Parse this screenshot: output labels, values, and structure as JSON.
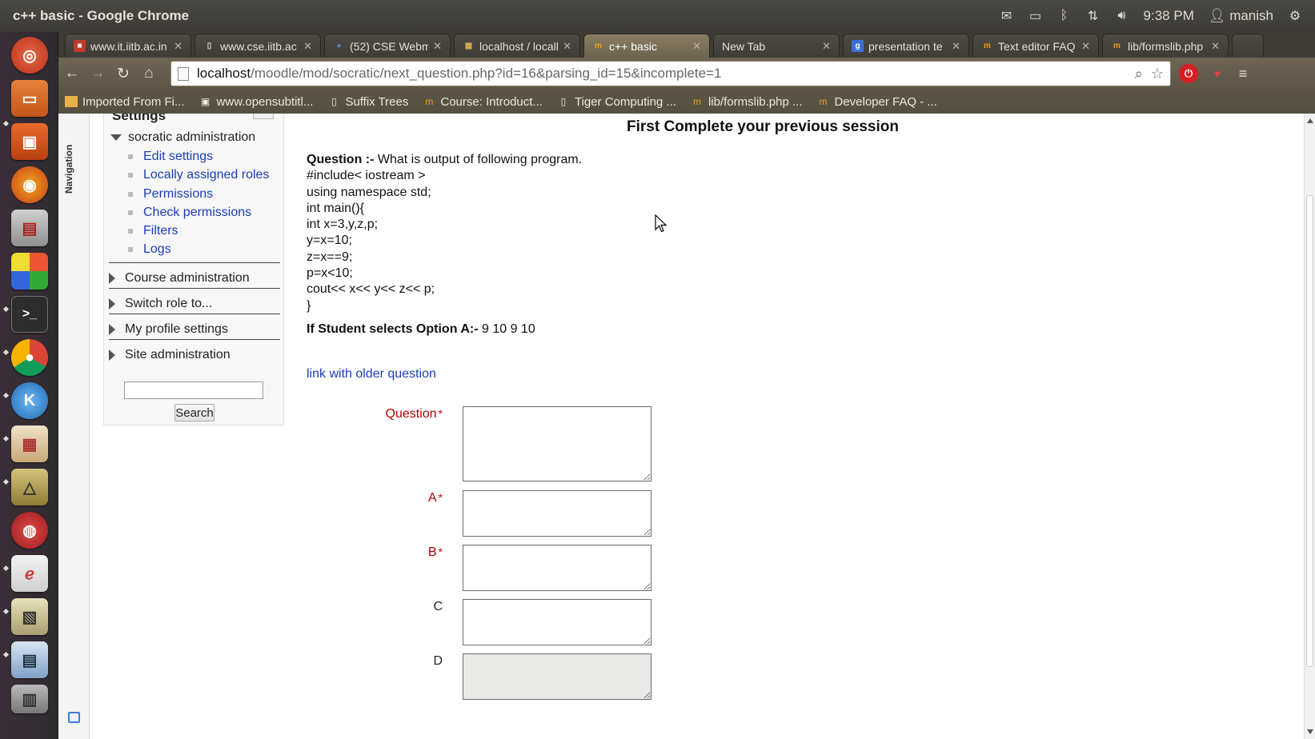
{
  "window_title": "c++ basic - Google Chrome",
  "panel": {
    "time": "9:38 PM",
    "user": "manish",
    "icons": [
      "mail-icon",
      "battery-icon",
      "bluetooth-icon",
      "network-icon",
      "volume-icon",
      "power-icon"
    ]
  },
  "tabs": [
    {
      "label": "www.it.iitb.ac.in",
      "icon_color": "#c0392b",
      "icon_char": "■"
    },
    {
      "label": "www.cse.iitb.ac",
      "icon_color": "#dddddd",
      "icon_char": "▯"
    },
    {
      "label": "(52) CSE Webma",
      "icon_color": "#4a7fd4",
      "icon_char": "●"
    },
    {
      "label": "localhost / locall",
      "icon_color": "#d9b24a",
      "icon_char": "▦"
    },
    {
      "label": "c++ basic",
      "icon_color": "#f29c1f",
      "icon_char": "m"
    },
    {
      "label": "New Tab",
      "icon_color": "",
      "icon_char": ""
    },
    {
      "label": "presentation te",
      "icon_color": "#3b6fd8",
      "icon_char": "g"
    },
    {
      "label": "Text editor FAQ",
      "icon_color": "#f29c1f",
      "icon_char": "m"
    },
    {
      "label": "lib/formslib.php",
      "icon_color": "#f29c1f",
      "icon_char": "m"
    }
  ],
  "omnibox": {
    "host": "localhost",
    "path": "/moodle/mod/socratic/next_question.php?id=16&parsing_id=15&incomplete=1"
  },
  "bookmarks": [
    {
      "label": "Imported From Fi...",
      "icon": "folder-icon"
    },
    {
      "label": "www.opensubtitl...",
      "icon": "film-icon"
    },
    {
      "label": "Suffix Trees",
      "icon": "page-icon"
    },
    {
      "label": "Course: Introduct...",
      "icon": "moodle-icon"
    },
    {
      "label": "Tiger Computing ...",
      "icon": "page-icon"
    },
    {
      "label": "lib/formslib.php ...",
      "icon": "moodle-icon"
    },
    {
      "label": "Developer FAQ - ...",
      "icon": "moodle-icon"
    }
  ],
  "nav_strip_label": "Navigation",
  "settings": {
    "title": "Settings",
    "root": "socratic administration",
    "links": [
      "Edit settings",
      "Locally assigned roles",
      "Permissions",
      "Check permissions",
      "Filters",
      "Logs"
    ],
    "branches": [
      "Course administration",
      "Switch role to...",
      "My profile settings",
      "Site administration"
    ],
    "search_value": "",
    "search_button": "Search"
  },
  "main": {
    "heading": "First Complete your previous session",
    "question_label": "Question :-",
    "question_text": "What is output of following program.",
    "code_lines": [
      "#include< iostream >",
      "using namespace std;",
      "int main(){",
      "int x=3,y,z,p;",
      "y=x=10;",
      "z=x==9;",
      "p=x<10;",
      "cout<< x<< y<< z<< p;",
      "}"
    ],
    "option_label": "If Student selects Option A:-",
    "option_value": "9 10 9 10",
    "older_link": "link with older question",
    "fields": [
      {
        "label": "Question",
        "required": true,
        "value": ""
      },
      {
        "label": "A",
        "required": true,
        "value": ""
      },
      {
        "label": "B",
        "required": true,
        "value": ""
      },
      {
        "label": "C",
        "required": false,
        "value": ""
      },
      {
        "label": "D",
        "required": false,
        "value": ""
      }
    ],
    "required_mark": "*"
  }
}
